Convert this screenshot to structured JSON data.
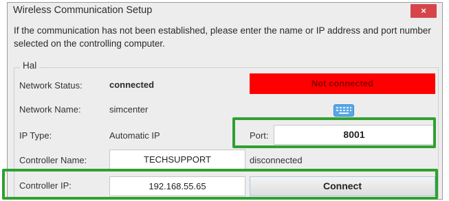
{
  "window": {
    "title": "Wireless Communication Setup",
    "close_glyph": "×",
    "instructions": "If the communication has not been established, please enter the name or IP address and port number selected on the controlling computer."
  },
  "group": {
    "legend": "Hal",
    "network_status": {
      "label": "Network Status:",
      "value": "connected",
      "badge": "Not connected",
      "badge_color": "#ff0000"
    },
    "network_name": {
      "label": "Network Name:",
      "value": "simcenter",
      "icon": "keyboard-icon"
    },
    "ip_type": {
      "label": "IP Type:",
      "value": "Automatic IP"
    },
    "port": {
      "label": "Port:",
      "value": "8001"
    },
    "controller_name": {
      "label": "Controller Name:",
      "value": "TECHSUPPORT",
      "status": "disconnected"
    },
    "controller_ip": {
      "label": "Controller IP:",
      "value": "192.168.55.65"
    },
    "connect_label": "Connect"
  },
  "highlight_color": "#2fa12f"
}
